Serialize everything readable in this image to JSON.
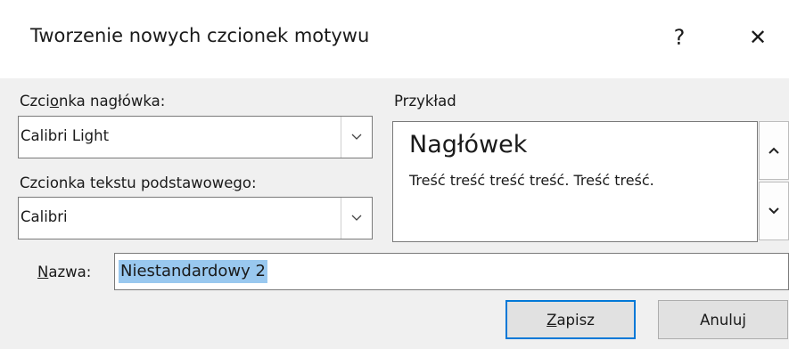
{
  "dialog": {
    "title": "Tworzenie nowych czcionek motywu",
    "help_glyph": "?",
    "close_glyph": "✕"
  },
  "heading_font": {
    "label_pre": "Czci",
    "label_u": "o",
    "label_post": "nka nagłówka:",
    "value": "Calibri Light"
  },
  "body_font": {
    "label_pre": "Czcionka tekstu podstawowe",
    "label_u": "g",
    "label_post": "o:",
    "value": "Calibri"
  },
  "preview": {
    "label": "Przykład",
    "heading_text": "Nagłówek",
    "body_text": "Treść treść treść treść. Treść treść."
  },
  "name": {
    "label_u": "N",
    "label_post": "azwa:",
    "value": "Niestandardowy 2"
  },
  "buttons": {
    "save_u": "Z",
    "save_post": "apisz",
    "cancel": "Anuluj"
  },
  "colors": {
    "accent": "#0078d7",
    "selection": "#99c8ef"
  }
}
